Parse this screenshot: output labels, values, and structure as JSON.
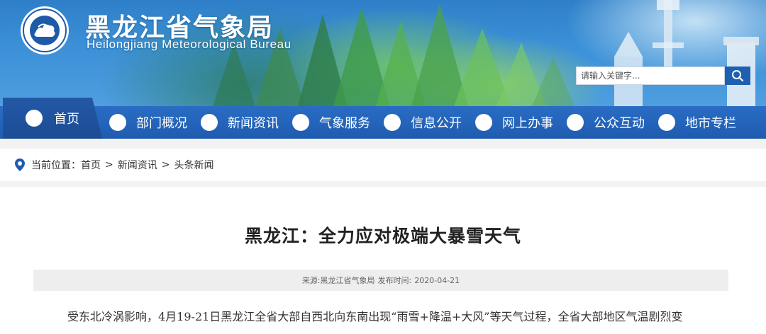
{
  "header": {
    "title": "黑龙江省气象局",
    "subtitle": "Heilongjiang  Meteorological  Bureau",
    "logo_icon": "meteorological-bureau-emblem",
    "colors": {
      "banner": "#3a8fd6",
      "nav": "#2a6cc4",
      "nav_home": "#1b4c95"
    }
  },
  "search": {
    "placeholder": "请输入关键字...",
    "button_icon": "search-icon"
  },
  "nav": {
    "items": [
      {
        "label": "首页",
        "icon": "circle-dot-icon"
      },
      {
        "label": "部门概况",
        "icon": "circle-dot-icon"
      },
      {
        "label": "新闻资讯",
        "icon": "circle-dot-icon"
      },
      {
        "label": "气象服务",
        "icon": "circle-dot-icon"
      },
      {
        "label": "信息公开",
        "icon": "circle-dot-icon"
      },
      {
        "label": "网上办事",
        "icon": "circle-dot-icon"
      },
      {
        "label": "公众互动",
        "icon": "circle-dot-icon"
      },
      {
        "label": "地市专栏",
        "icon": "circle-dot-icon"
      }
    ]
  },
  "breadcrumb": {
    "prefix": "当前位置：",
    "items": [
      "首页",
      "新闻资讯",
      "头条新闻"
    ],
    "separator": ">",
    "icon": "location-pin-icon"
  },
  "article": {
    "title": "黑龙江：全力应对极端大暴雪天气",
    "source_label": "来源:",
    "source": "黑龙江省气象局",
    "date_label": "发布时间:",
    "date": "2020-04-21",
    "first_line": "受东北冷涡影响，4月19-21日黑龙江全省大部自西北向东南出现“雨雪+降温+大风”等天气过程，全省大部地区气温剧烈变"
  }
}
